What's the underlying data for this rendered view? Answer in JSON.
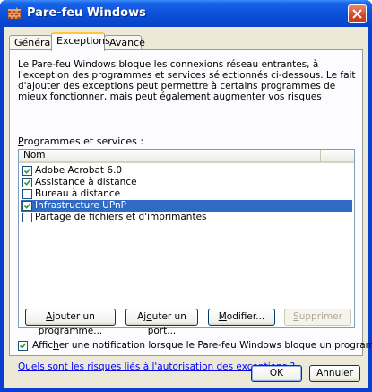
{
  "window": {
    "title": "Pare-feu Windows",
    "icon": "firewall-icon",
    "close_icon": "close-icon"
  },
  "tabs": [
    {
      "label": "Général",
      "active": false
    },
    {
      "label": "Exceptions",
      "active": true
    },
    {
      "label": "Avancé",
      "active": false
    }
  ],
  "description": "Le Pare-feu Windows bloque les connexions réseau entrantes, à l'exception des programmes et services sélectionnés ci-dessous. Le fait d'ajouter des exceptions peut permettre à certains programmes de mieux fonctionner, mais peut également augmenter vos risques",
  "programs": {
    "label_accel": "P",
    "label_rest": "rogrammes et services :",
    "column_header": "Nom",
    "items": [
      {
        "label": "Adobe Acrobat 6.0",
        "checked": true,
        "selected": false
      },
      {
        "label": "Assistance à distance",
        "checked": true,
        "selected": false
      },
      {
        "label": "Bureau à distance",
        "checked": false,
        "selected": false
      },
      {
        "label": "Infrastructure UPnP",
        "checked": true,
        "selected": true
      },
      {
        "label": "Partage de fichiers et d'imprimantes",
        "checked": false,
        "selected": false
      }
    ]
  },
  "buttons": {
    "add_program_accel": "A",
    "add_program_rest": "jouter un programme...",
    "add_port_pre": "Aj",
    "add_port_accel": "o",
    "add_port_rest": "uter un port...",
    "modify_accel": "M",
    "modify_rest": "odifier...",
    "delete_accel": "S",
    "delete_rest": "upprimer",
    "ok": "OK",
    "cancel": "Annuler"
  },
  "notification": {
    "checked": true,
    "pre": "Affic",
    "accel": "h",
    "rest": "er une notification lorsque le Pare-feu Windows bloque un programme"
  },
  "link": "Quels sont les risques liés à l'autorisation des exceptions ?",
  "colors": {
    "titlebar": "#0a4fd8",
    "selection": "#316ac5",
    "tab_highlight": "#ffc83c",
    "link": "#0000ff"
  }
}
